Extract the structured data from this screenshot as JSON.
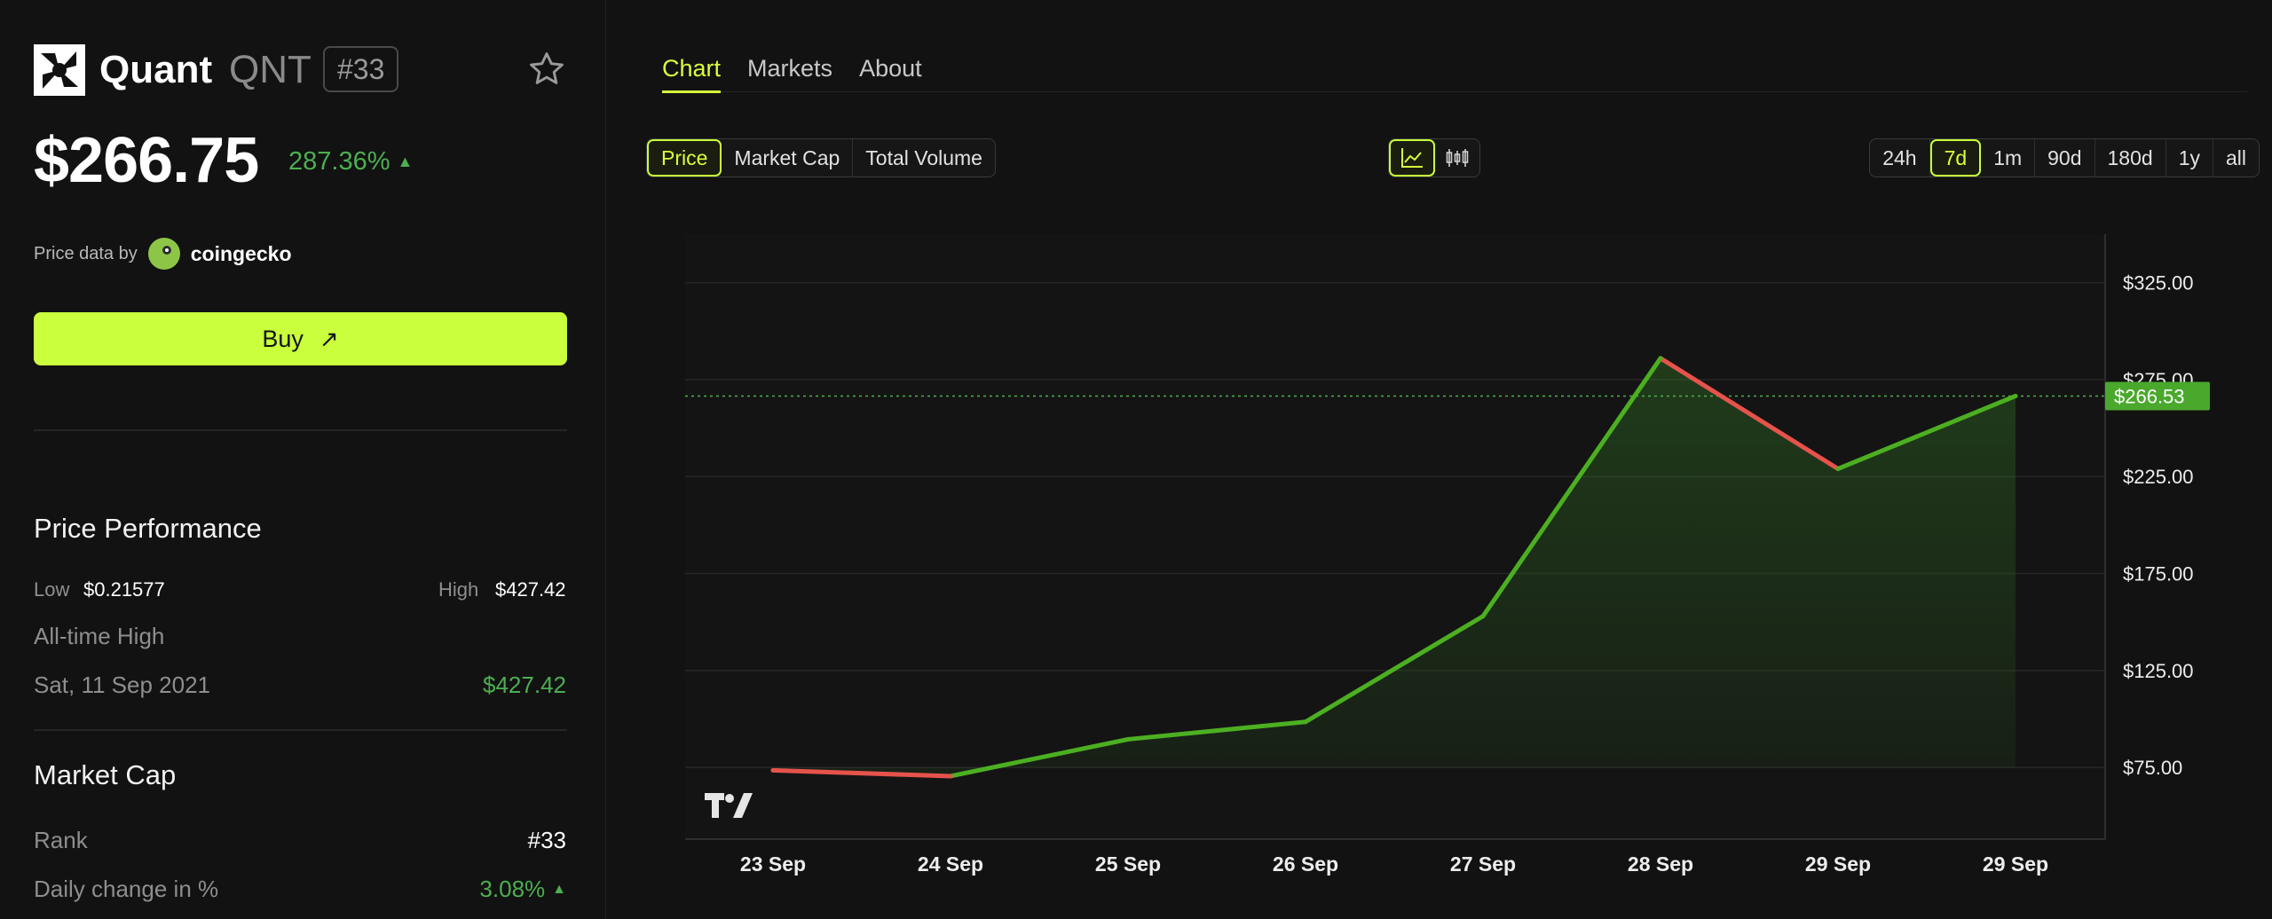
{
  "coin": {
    "name": "Quant",
    "symbol": "QNT",
    "rank_badge": "#33",
    "price": "$266.75",
    "change": "287.36%",
    "change_arrow": "▲",
    "price_data_label": "Price data by",
    "provider": "coingecko",
    "buy_label": "Buy",
    "buy_arrow": "↗"
  },
  "performance": {
    "title": "Price Performance",
    "low_label": "Low",
    "low_value": "$0.21577",
    "high_label": "High",
    "high_value": "$427.42",
    "ath_label": "All-time High",
    "ath_date": "Sat, 11 Sep 2021",
    "ath_value": "$427.42"
  },
  "market_cap": {
    "title": "Market Cap",
    "rank_label": "Rank",
    "rank_value": "#33",
    "daily_change_label": "Daily change in %",
    "daily_change_value": "3.08%",
    "daily_change_arrow": "▲"
  },
  "tabs": [
    {
      "label": "Chart",
      "active": true
    },
    {
      "label": "Markets",
      "active": false
    },
    {
      "label": "About",
      "active": false
    }
  ],
  "metric_buttons": [
    {
      "label": "Price",
      "active": true
    },
    {
      "label": "Market Cap",
      "active": false
    },
    {
      "label": "Total Volume",
      "active": false
    }
  ],
  "chart_type_buttons": [
    {
      "icon": "line-chart-icon",
      "active": true
    },
    {
      "icon": "candlestick-icon",
      "active": false
    }
  ],
  "range_buttons": [
    {
      "label": "24h",
      "active": false
    },
    {
      "label": "7d",
      "active": true
    },
    {
      "label": "1m",
      "active": false
    },
    {
      "label": "90d",
      "active": false
    },
    {
      "label": "180d",
      "active": false
    },
    {
      "label": "1y",
      "active": false
    },
    {
      "label": "all",
      "active": false
    }
  ],
  "colors": {
    "accent": "#c9ff3c",
    "up": "#4caf50",
    "down": "#e5534b",
    "background": "#121212"
  },
  "chart_data": {
    "type": "line",
    "categories": [
      "23 Sep",
      "24 Sep",
      "25 Sep",
      "26 Sep",
      "27 Sep",
      "28 Sep",
      "29 Sep",
      "29 Sep"
    ],
    "values": [
      73.5,
      70.5,
      89.5,
      98.5,
      153,
      286,
      229,
      266.53
    ],
    "y_ticks": [
      75,
      125,
      175,
      225,
      275,
      325
    ],
    "y_tick_labels": [
      "$75.00",
      "$125.00",
      "$175.00",
      "$225.00",
      "$275.00",
      "$325.00"
    ],
    "ylim": [
      38,
      350
    ],
    "current_value": 266.53,
    "current_label": "$266.53",
    "baseline": 75,
    "grid": true,
    "watermark": "TV"
  }
}
